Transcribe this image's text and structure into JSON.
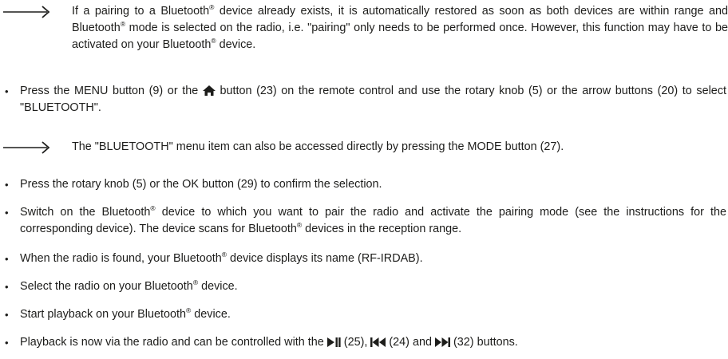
{
  "note1": {
    "part1": "If a pairing to a Bluetooth",
    "reg": "®",
    "part2": " device already exists, it is automatically restored as soon as both devices are within range and Bluetooth",
    "part3": " mode is selected on the radio, i.e. \"pairing\" only needs to be performed once. However, this function may have to be activated on your Bluetooth",
    "part4": " device."
  },
  "bullet1": {
    "part1": "Press the MENU button (9) or the ",
    "icon": "home-icon",
    "part2": " button (23) on the remote control and use the rotary knob (5) or the arrow buttons (20) to select \"BLUETOOTH\"."
  },
  "note2": {
    "text": "The \"BLUETOOTH\" menu item can also be accessed directly by pressing the MODE button (27)."
  },
  "bullet2": {
    "text": "Press the rotary knob (5) or the OK button (29) to confirm the selection."
  },
  "bullet3": {
    "part1": "Switch on the Bluetooth",
    "part2": " device to which you want to pair the radio and activate the pairing mode (see the instructions for the corresponding device). The device scans for Bluetooth",
    "part3": " devices in the reception range."
  },
  "bullet4": {
    "part1": "When the radio is found, your Bluetooth",
    "part2": " device displays its name (RF-IRDAB)."
  },
  "bullet5": {
    "part1": "Select the radio on your Bluetooth",
    "part2": " device."
  },
  "bullet6": {
    "part1": "Start playback on your Bluetooth",
    "part2": " device."
  },
  "bullet7": {
    "part1": "Playback is now via the radio and can be controlled with the ",
    "num1": " (25), ",
    "num2": " (24) and ",
    "num3": " (32) buttons.",
    "icons": [
      "play-pause-icon",
      "skip-back-icon",
      "skip-forward-icon"
    ]
  },
  "bullet_char": "•"
}
